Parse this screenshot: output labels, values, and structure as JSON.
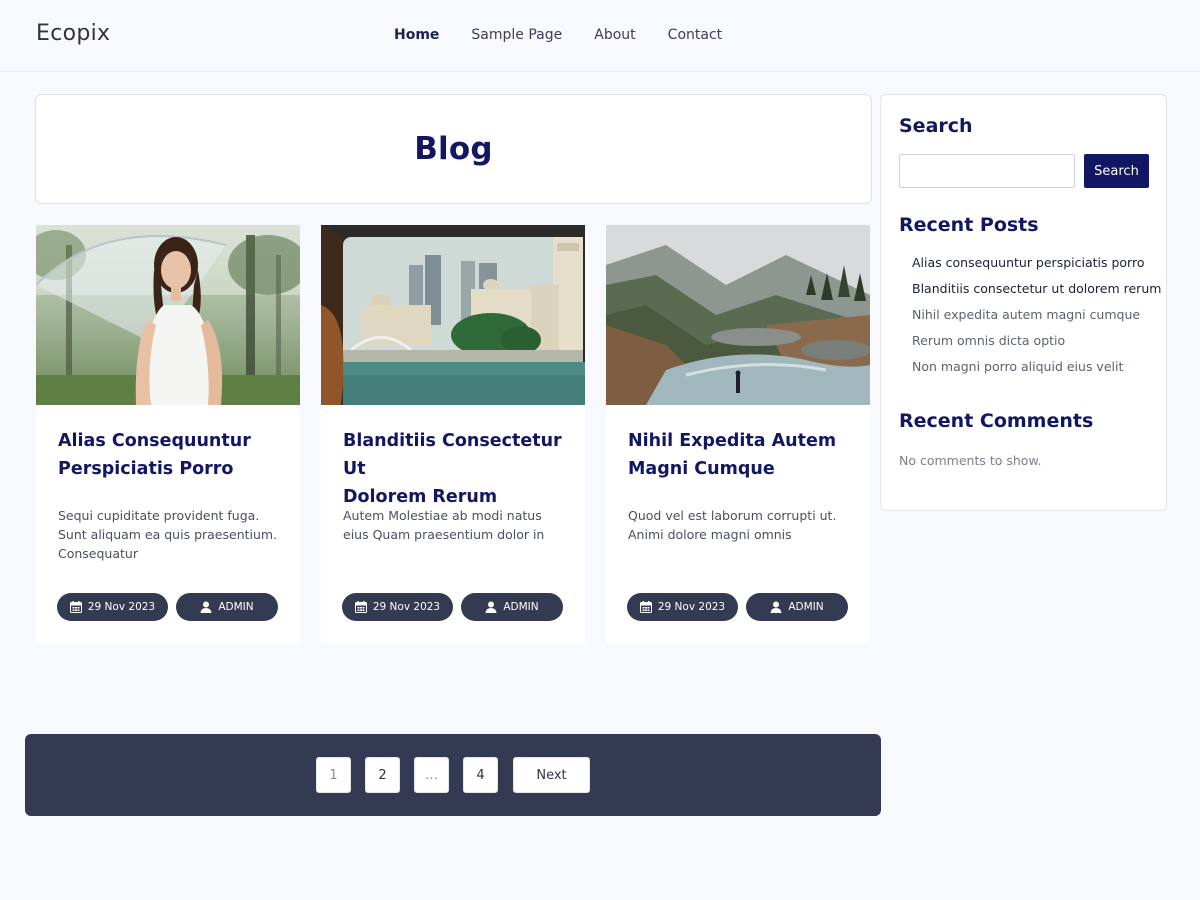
{
  "site": {
    "logo": "Ecopix"
  },
  "nav": {
    "items": [
      {
        "label": "Home",
        "active": true
      },
      {
        "label": "Sample Page"
      },
      {
        "label": "About"
      },
      {
        "label": "Contact"
      }
    ]
  },
  "page": {
    "title": "Blog"
  },
  "posts": [
    {
      "title_line1": "Alias Consequuntur",
      "title_line2": "Perspiciatis Porro",
      "excerpt": "Sequi cupiditate provident fuga. Sunt aliquam ea quis praesentium. Consequatur",
      "date": "29 Nov 2023",
      "author": "ADMIN",
      "image": "woman-with-umbrella-photo"
    },
    {
      "title_line1": "Blanditiis Consectetur Ut",
      "title_line2": "Dolorem Rerum",
      "excerpt": "Autem Molestiae ab modi natus eius Quam praesentium dolor in",
      "date": "29 Nov 2023",
      "author": "ADMIN",
      "image": "city-river-photo"
    },
    {
      "title_line1": "Nihil Expedita Autem",
      "title_line2": "Magni Cumque",
      "excerpt": "Quod vel est laborum corrupti ut. Animi dolore magni omnis",
      "date": "29 Nov 2023",
      "author": "ADMIN",
      "image": "mountain-river-photo"
    }
  ],
  "pagination": {
    "pages": [
      "1",
      "2",
      "…",
      "4"
    ],
    "current": "1",
    "next_label": "Next"
  },
  "sidebar": {
    "search_title": "Search",
    "search_placeholder": "",
    "search_button": "Search",
    "recent_posts_title": "Recent Posts",
    "recent_posts": [
      "Alias consequuntur perspiciatis porro",
      "Blanditiis consectetur ut dolorem rerum",
      "Nihil expedita autem magni cumque",
      "Rerum omnis dicta optio",
      "Non magni porro aliquid eius velit"
    ],
    "recent_comments_title": "Recent Comments",
    "no_comments": "No comments to show."
  },
  "colors": {
    "page_bg": "#f8f9fc",
    "heading": "#121763",
    "pill_bg": "#333a52",
    "pagination_bg": "#333a52",
    "search_button": "#121763"
  },
  "icons": {
    "date": "calendar-icon",
    "author": "user-icon"
  }
}
